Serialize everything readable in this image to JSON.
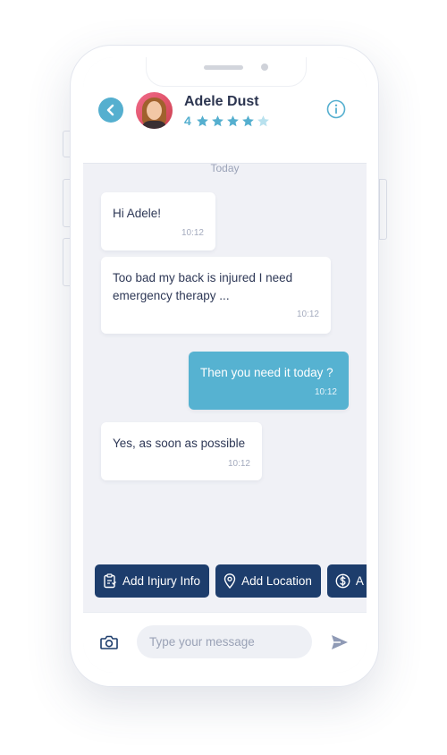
{
  "contact": {
    "name": "Adele Dust",
    "rating": "4",
    "stars_filled": 4,
    "stars_total": 5
  },
  "conversation": {
    "date_label": "Today",
    "messages": [
      {
        "direction": "in",
        "text": "Hi Adele!",
        "time": "10:12"
      },
      {
        "direction": "in",
        "text": "Too bad my back is injured I need\nemergency therapy ...",
        "time": "10:12"
      },
      {
        "direction": "out",
        "text": "Then you need it today ?",
        "time": "10:12"
      },
      {
        "direction": "in",
        "text": "Yes, as soon as possible",
        "time": "10:12"
      }
    ]
  },
  "quick_actions": [
    {
      "label": "Add Injury Info",
      "icon": "clipboard-icon"
    },
    {
      "label": "Add Location",
      "icon": "location-pin-icon"
    },
    {
      "label": "A",
      "icon": "dollar-icon"
    }
  ],
  "composer": {
    "placeholder": "Type your message",
    "camera_icon": "camera-icon",
    "send_icon": "send-icon"
  },
  "colors": {
    "accent": "#55afcf",
    "navy": "#1d3d6c",
    "text": "#2c3550",
    "background": "#f0f1f6",
    "star_empty": "#b8e1ee"
  }
}
